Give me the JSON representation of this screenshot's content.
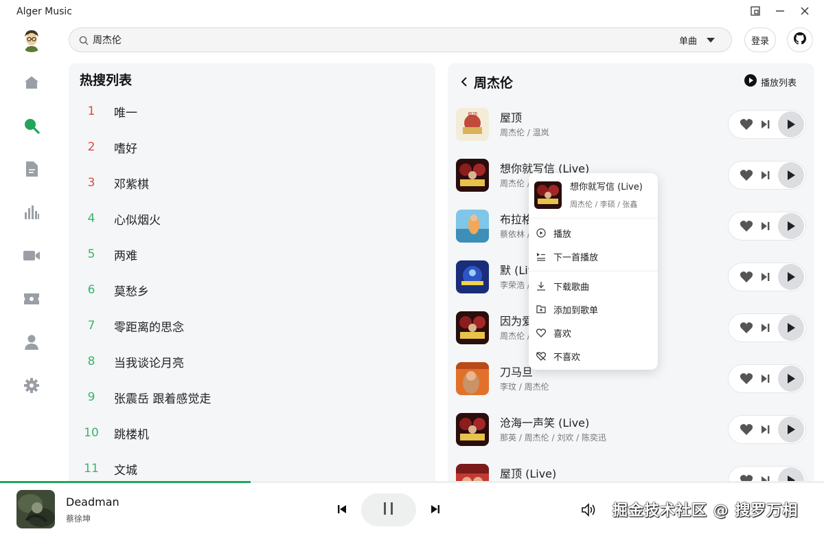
{
  "window": {
    "title": "Alger Music",
    "controls": [
      "restore-icon",
      "minimize-icon",
      "close-icon"
    ]
  },
  "header": {
    "search_value": "周杰伦",
    "search_type": "单曲",
    "login_label": "登录",
    "github_icon": "github-icon"
  },
  "sidebar": {
    "items": [
      {
        "icon": "home-icon",
        "active": false
      },
      {
        "icon": "search-icon",
        "active": true
      },
      {
        "icon": "document-icon",
        "active": false
      },
      {
        "icon": "chart-icon",
        "active": false
      },
      {
        "icon": "video-icon",
        "active": false
      },
      {
        "icon": "ticket-icon",
        "active": false
      },
      {
        "icon": "user-icon",
        "active": false
      },
      {
        "icon": "gear-icon",
        "active": false
      }
    ]
  },
  "hot_search": {
    "title": "热搜列表",
    "items": [
      {
        "rank": "1",
        "name": "唯一"
      },
      {
        "rank": "2",
        "name": "嗜好"
      },
      {
        "rank": "3",
        "name": "邓紫棋"
      },
      {
        "rank": "4",
        "name": "心似烟火"
      },
      {
        "rank": "5",
        "name": "两难"
      },
      {
        "rank": "6",
        "name": "莫愁乡"
      },
      {
        "rank": "7",
        "name": "零距离的思念"
      },
      {
        "rank": "8",
        "name": "当我谈论月亮"
      },
      {
        "rank": "9",
        "name": "张震岳 跟着感觉走"
      },
      {
        "rank": "10",
        "name": "跳楼机"
      },
      {
        "rank": "11",
        "name": "文城"
      }
    ]
  },
  "results": {
    "header": "周杰伦",
    "playlist_label": "播放列表",
    "songs": [
      {
        "title": "屋顶",
        "artist": "周杰伦 / 温岚",
        "cover": "gold"
      },
      {
        "title": "想你就写信 (Live)",
        "artist": "周杰伦 / 李硕 / 张鑫",
        "cover": "red"
      },
      {
        "title": "布拉格广场",
        "artist": "蔡依林 / 周杰伦",
        "cover": "blue"
      },
      {
        "title": "默 (Live)",
        "artist": "李荣浩 / 周杰伦",
        "cover": "stage"
      },
      {
        "title": "因为爱情",
        "artist": "周杰伦 / 陈奕迅",
        "cover": "red"
      },
      {
        "title": "刀马旦",
        "artist": "李玟 / 周杰伦",
        "cover": "orange"
      },
      {
        "title": "沧海一声笑 (Live)",
        "artist": "那英 / 周杰伦 / 刘欢 / 陈奕迅",
        "cover": "red"
      },
      {
        "title": "屋顶 (Live)",
        "artist": "",
        "cover": "crowd"
      }
    ]
  },
  "context_menu": {
    "title": "想你就写信 (Live)",
    "artist": "周杰伦 / 李硕 / 张鑫",
    "items": [
      {
        "label": "播放",
        "icon": "play-circle-icon"
      },
      {
        "label": "下一首播放",
        "icon": "play-next-icon"
      },
      {
        "label": "下载歌曲",
        "icon": "download-icon"
      },
      {
        "label": "添加到歌单",
        "icon": "add-to-playlist-icon"
      },
      {
        "label": "喜欢",
        "icon": "heart-outline-icon"
      },
      {
        "label": "不喜欢",
        "icon": "dislike-icon"
      }
    ]
  },
  "player": {
    "title": "Deadman",
    "artist": "蔡徐坤",
    "progress": 0.304,
    "watermark": "掘金技术社区 @ 搜罗万相"
  },
  "colors": {
    "accent": "#22a559",
    "rank_top": "#e04848",
    "rank_rest": "#3bb36c"
  }
}
